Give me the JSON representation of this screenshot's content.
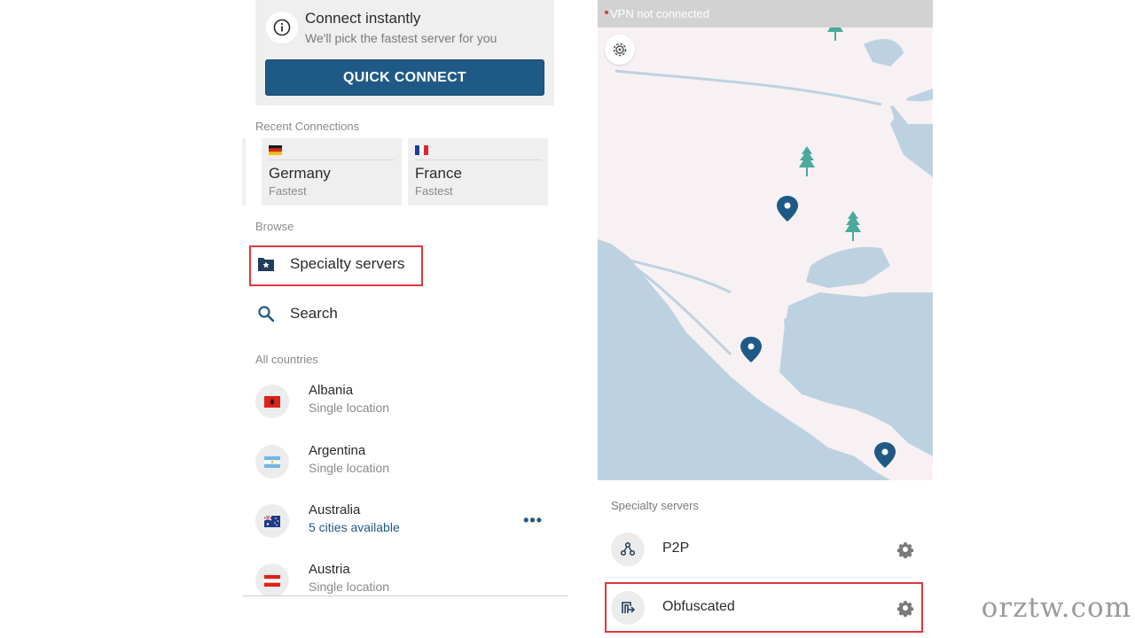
{
  "quick_connect": {
    "title": "Connect instantly",
    "subtitle": "We'll pick the fastest server for you",
    "button_label": "QUICK CONNECT"
  },
  "recent": {
    "label": "Recent Connections",
    "items": [
      {
        "name": "Germany",
        "sub": "Fastest",
        "flag": "germany-flag"
      },
      {
        "name": "France",
        "sub": "Fastest",
        "flag": "france-flag"
      }
    ]
  },
  "browse": {
    "label": "Browse",
    "specialty": "Specialty servers",
    "search": "Search"
  },
  "countries": {
    "label": "All countries",
    "items": [
      {
        "name": "Albania",
        "sub": "Single location"
      },
      {
        "name": "Argentina",
        "sub": "Single location"
      },
      {
        "name": "Australia",
        "sub": "5 cities available"
      },
      {
        "name": "Austria",
        "sub": "Single location"
      }
    ],
    "more_glyph": "•••"
  },
  "map": {
    "status": "VPN not connected",
    "colors": {
      "land": "#f7f1f3",
      "water": "#bdd2e1",
      "pin": "#1f5a86",
      "tree": "#4aa99b"
    }
  },
  "specialty": {
    "label": "Specialty servers",
    "items": [
      {
        "name": "P2P",
        "icon": "p2p-icon"
      },
      {
        "name": "Obfuscated",
        "icon": "obfuscated-icon"
      }
    ]
  },
  "watermark": "orztw.com",
  "colors": {
    "accent": "#1f5a86",
    "highlight": "#e0383e"
  }
}
